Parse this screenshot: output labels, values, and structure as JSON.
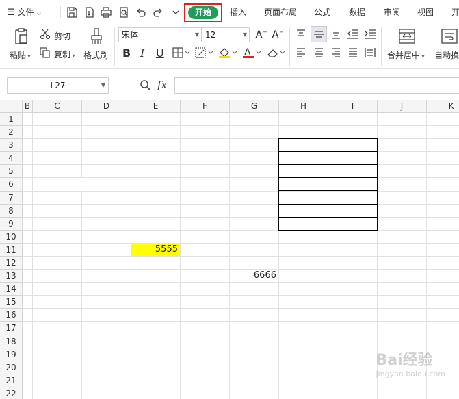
{
  "menubar": {
    "hamburger_label": "文件",
    "start": "开始",
    "tabs": [
      "插入",
      "页面布局",
      "公式",
      "数据",
      "审阅",
      "视图",
      "开"
    ]
  },
  "ribbon": {
    "paste": "粘贴",
    "cut": "剪切",
    "copy": "复制",
    "format_painter": "格式刷",
    "font_name": "宋体",
    "font_size": "12",
    "merge_center": "合并居中",
    "wrap_text": "自动换"
  },
  "formula_bar": {
    "name_box": "L27",
    "fx": "fx",
    "formula": ""
  },
  "grid": {
    "columns": [
      "B",
      "C",
      "D",
      "E",
      "F",
      "G",
      "H",
      "I",
      "J",
      "K"
    ],
    "rows": [
      "1",
      "2",
      "3",
      "4",
      "5",
      "6",
      "7",
      "8",
      "9",
      "10",
      "11",
      "12",
      "13",
      "14",
      "15",
      "16",
      "17",
      "18",
      "19",
      "20",
      "21",
      "22"
    ],
    "cells": {
      "E11": "5555",
      "G13": "6666"
    },
    "fill_colors": {
      "E11": "#ffff00"
    }
  },
  "watermark": {
    "brand": "Bai经验",
    "url": "jingyan.baidu.com"
  }
}
